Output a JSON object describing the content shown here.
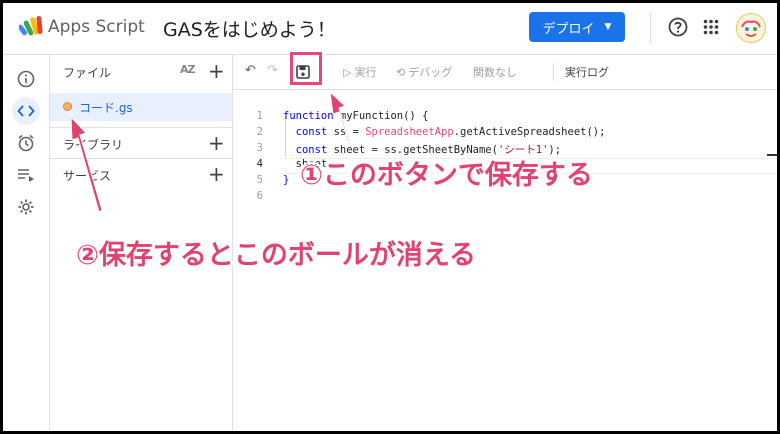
{
  "header": {
    "app_name": "Apps Script",
    "project_title": "GASをはじめよう！",
    "deploy_label": "デプロイ",
    "brand_color": "#1a73e8"
  },
  "file_panel": {
    "title": "ファイル",
    "sort_icon_text": "AZ",
    "files": [
      {
        "name": "コード.gs",
        "status": "unsaved-dot"
      }
    ],
    "sections": [
      {
        "label": "ライブラリ"
      },
      {
        "label": "サービス"
      }
    ]
  },
  "toolbar": {
    "run_label": "実行",
    "debug_label": "デバッグ",
    "function_select": "関数なし",
    "log_label": "実行ログ"
  },
  "editor": {
    "line_numbers": [
      "1",
      "2",
      "3",
      "4",
      "5",
      "6"
    ],
    "lines": [
      {
        "kw": "function",
        "text": " myFunction() {"
      },
      {
        "indent": "  ",
        "kw": "const",
        "text": " ss = ",
        "cls": "SpreadsheetApp",
        "rest": ".getActiveSpreadsheet();"
      },
      {
        "indent": "  ",
        "kw": "const",
        "text": " sheet = ss.getSheetByName(",
        "str": "'シート1'",
        "rest": ");"
      },
      {
        "indent": "  ",
        "text": "sheet."
      },
      {
        "text": "}"
      },
      {
        "text": ""
      }
    ]
  },
  "annotations": {
    "callout_1": "①このボタンで保存する",
    "callout_2": "②保存するとこのボールが消える",
    "accent_color": "#e0436f"
  }
}
